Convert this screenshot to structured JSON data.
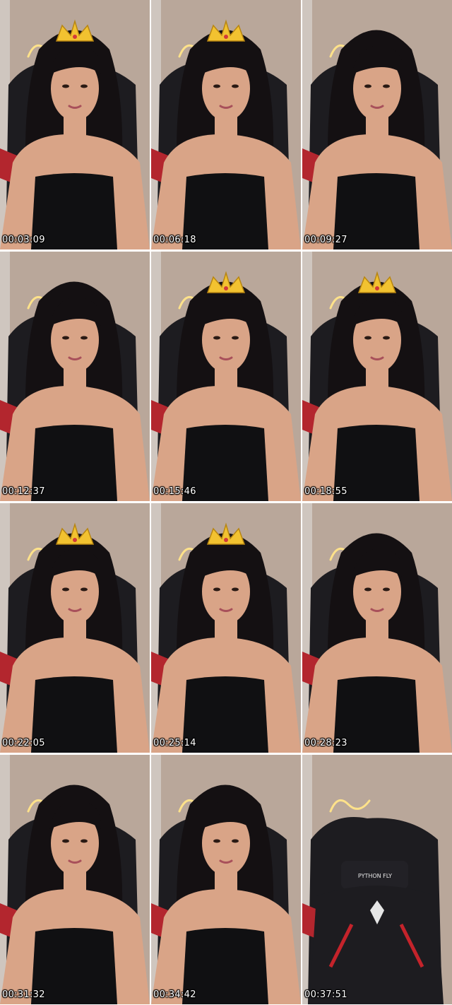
{
  "grid": {
    "columns": 3,
    "rows": 4
  },
  "colors": {
    "wall": "#b9a79a",
    "hair": "#141012",
    "skin": "#d9a487",
    "top": "#101012",
    "chair": "#1d1c20",
    "neon": "#ffe28a",
    "crown": "#f2c230"
  },
  "frames": [
    {
      "timestamp": "00:03:09",
      "crown": true,
      "chair_only": false
    },
    {
      "timestamp": "00:06:18",
      "crown": true,
      "chair_only": false
    },
    {
      "timestamp": "00:09:27",
      "crown": false,
      "chair_only": false
    },
    {
      "timestamp": "00:12:37",
      "crown": false,
      "chair_only": false
    },
    {
      "timestamp": "00:15:46",
      "crown": true,
      "chair_only": false
    },
    {
      "timestamp": "00:18:55",
      "crown": true,
      "chair_only": false
    },
    {
      "timestamp": "00:22:05",
      "crown": true,
      "chair_only": false
    },
    {
      "timestamp": "00:25:14",
      "crown": true,
      "chair_only": false
    },
    {
      "timestamp": "00:28:23",
      "crown": false,
      "chair_only": false
    },
    {
      "timestamp": "00:31:32",
      "crown": false,
      "chair_only": false
    },
    {
      "timestamp": "00:34:42",
      "crown": false,
      "chair_only": false
    },
    {
      "timestamp": "00:37:51",
      "crown": false,
      "chair_only": true,
      "chair_brand": "PYTHON FLY"
    }
  ]
}
